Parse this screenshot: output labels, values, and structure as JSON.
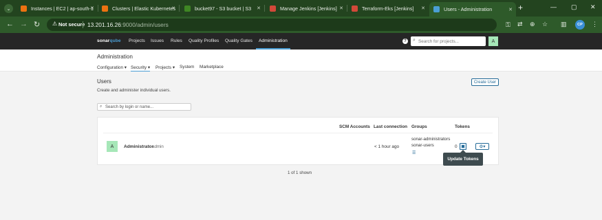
{
  "browser": {
    "tabs": [
      {
        "title": "Instances | EC2 | ap-south-1",
        "favicon_color": "#ec7211"
      },
      {
        "title": "Clusters | Elastic Kubernetes",
        "favicon_color": "#ec7211"
      },
      {
        "title": "bucket97 - S3 bucket | S3",
        "favicon_color": "#3f8624"
      },
      {
        "title": "Manage Jenkins [Jenkins]",
        "favicon_color": "#d24939"
      },
      {
        "title": "Terraform-Eks [Jenkins]",
        "favicon_color": "#d24939"
      },
      {
        "title": "Users - Administration",
        "favicon_color": "#4b9fd5"
      }
    ],
    "not_secure_label": "Not secure",
    "url_host": "13.201.16.26",
    "url_path": ":9000/admin/users",
    "profile_initials": "CP"
  },
  "sonar": {
    "logo_a": "sonar",
    "logo_b": "qube",
    "nav": [
      "Projects",
      "Issues",
      "Rules",
      "Quality Profiles",
      "Quality Gates",
      "Administration"
    ],
    "search_placeholder": "Search for projects...",
    "user_avatar": "A"
  },
  "admin": {
    "title": "Administration",
    "subnav": [
      "Configuration ▾",
      "Security ▾",
      "Projects ▾",
      "System",
      "Marketplace"
    ]
  },
  "users": {
    "title": "Users",
    "description": "Create and administer individual users.",
    "create_button": "Create User",
    "search_placeholder": "Search by login or name...",
    "columns": [
      "SCM Accounts",
      "Last connection",
      "Groups",
      "Tokens"
    ],
    "rows": [
      {
        "avatar": "A",
        "name": "Administrator",
        "login": "admin",
        "last_connection": "< 1 hour ago",
        "groups": [
          "sonar-administrators",
          "sonar-users"
        ],
        "tokens": "0"
      }
    ],
    "tooltip": "Update Tokens",
    "footer": "1 of 1 shown"
  }
}
